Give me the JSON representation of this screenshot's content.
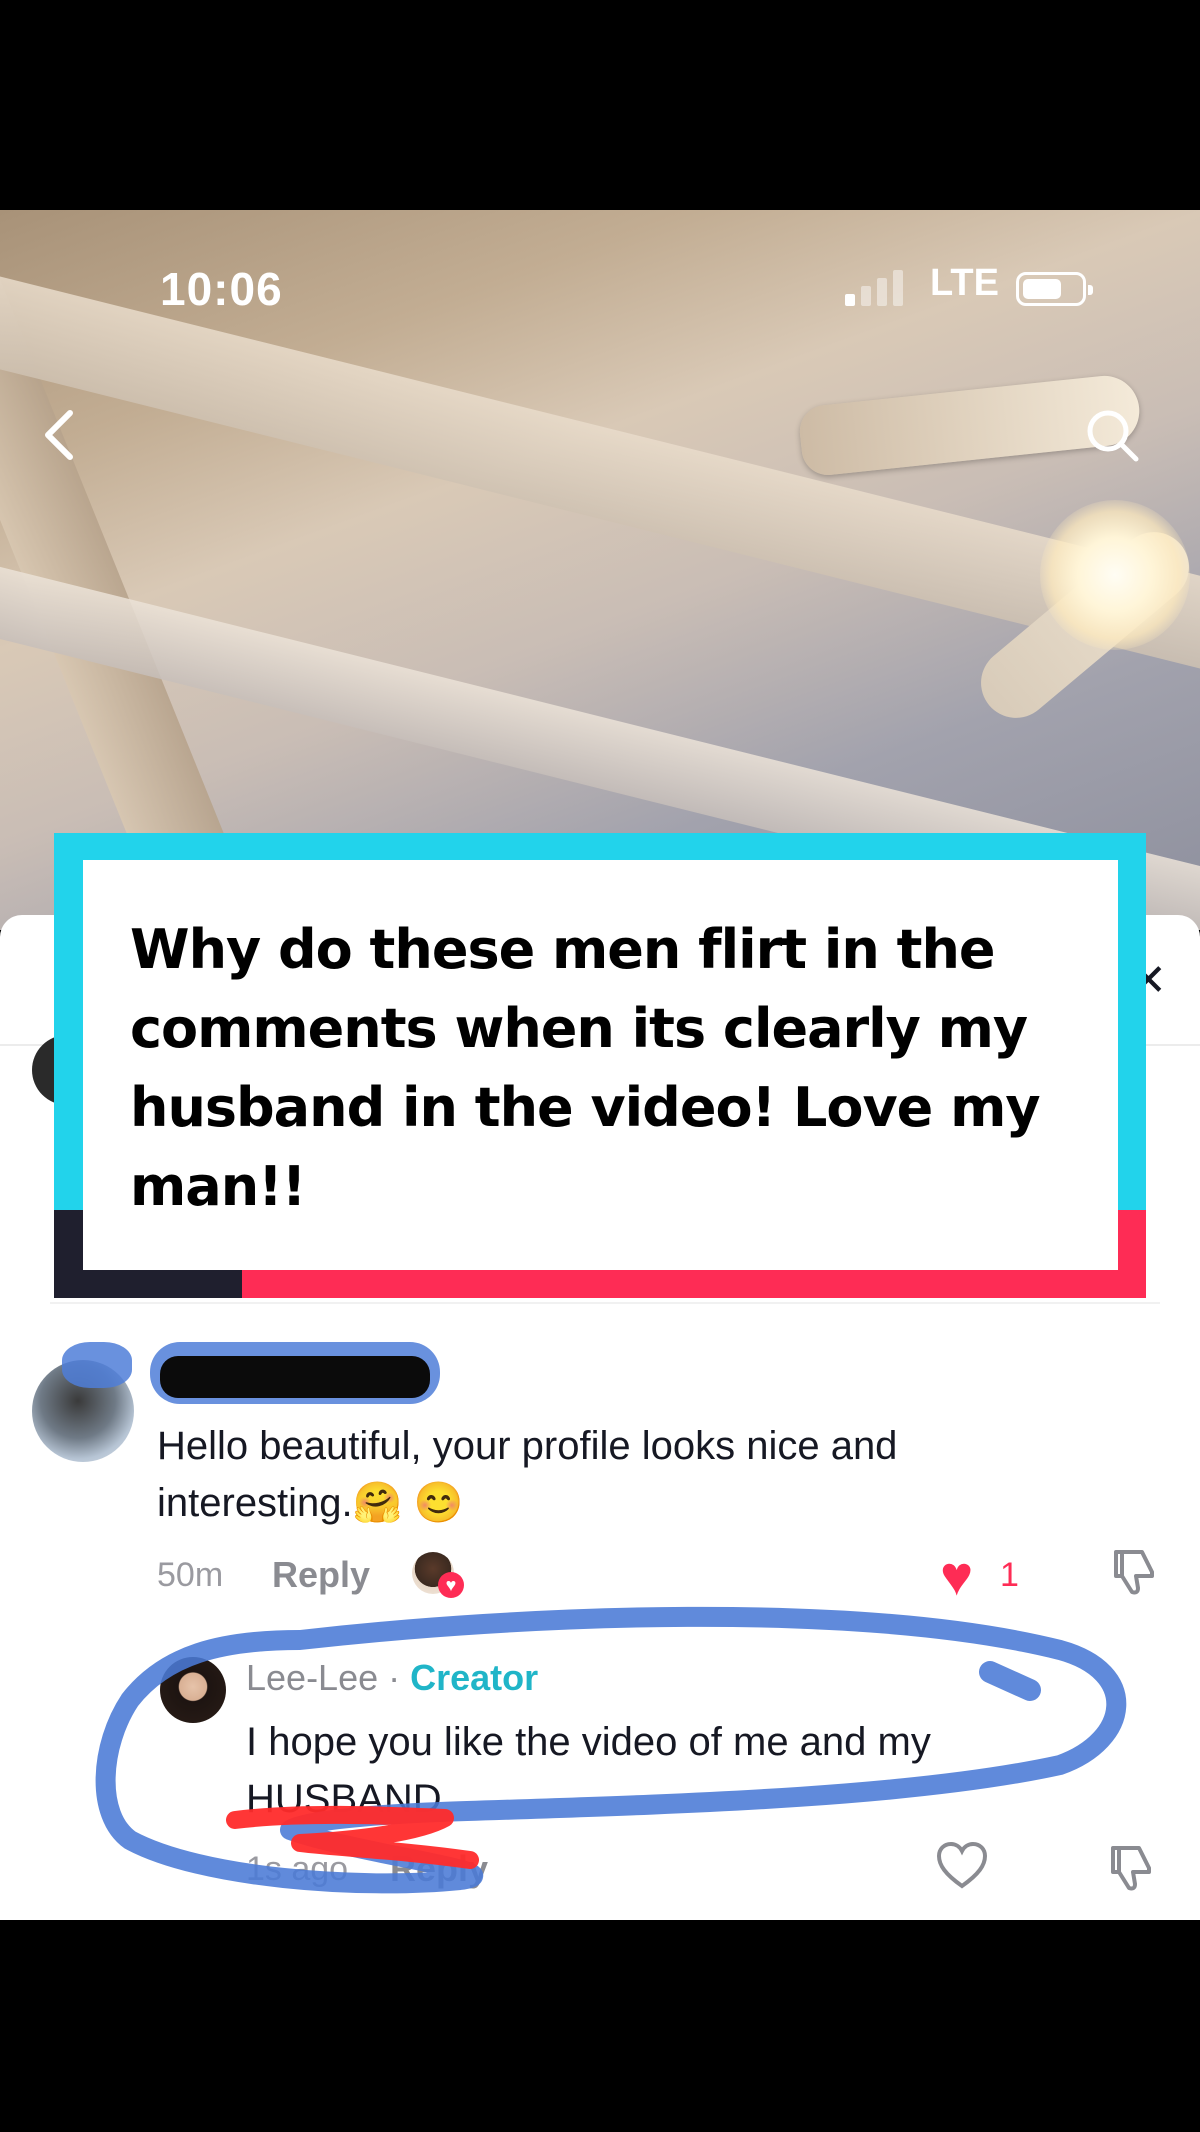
{
  "status_bar": {
    "time": "10:06",
    "network": "LTE"
  },
  "video": {
    "back_icon": "chevron-left-icon",
    "search_icon": "search-icon"
  },
  "caption": {
    "text": "Why do these men flirt in the comments when its clearly my husband in the video! Love my man!!"
  },
  "comments": [
    {
      "username": "",
      "text": "Hello beautiful, your profile looks nice and interesting.🤗 😊",
      "age": "50m",
      "reply_label": "Reply",
      "like_count": "1",
      "liked_by_creator": true
    },
    {
      "username": "Lee-Lee",
      "separator": " · ",
      "badge": "Creator",
      "text": "I hope you like the video of me and my HUSBAND",
      "age": "1s ago",
      "reply_label": "Reply"
    }
  ],
  "colors": {
    "accent_red": "#fe2c55",
    "accent_cyan": "#22d3eb",
    "scribble_blue": "#4f7ed8"
  }
}
